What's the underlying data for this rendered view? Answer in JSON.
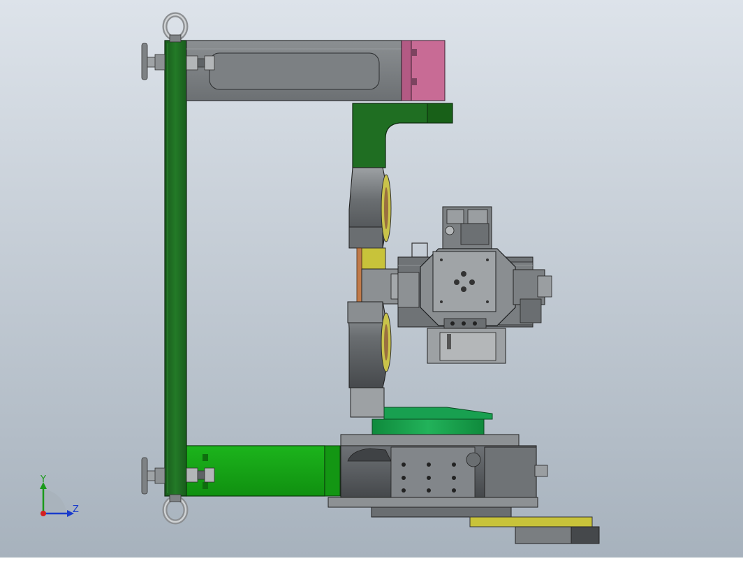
{
  "triad": {
    "y_label": "Y",
    "z_label": "Z",
    "y_color": "#1a9a1a",
    "z_color": "#1a3ccc",
    "origin_color": "#d42020"
  },
  "colors": {
    "background_top": "#dfe5ec",
    "background_bottom": "#a9b4bf",
    "frame_green": "#1f6a22",
    "bright_green": "#1aa51a",
    "arm_gray": "#7a7d80",
    "housing_dark": "#5b5f63",
    "pink_block": "#c86b95",
    "olive_yellow": "#c8c33a",
    "copper": "#c07a4a",
    "teal_green": "#18a050"
  }
}
